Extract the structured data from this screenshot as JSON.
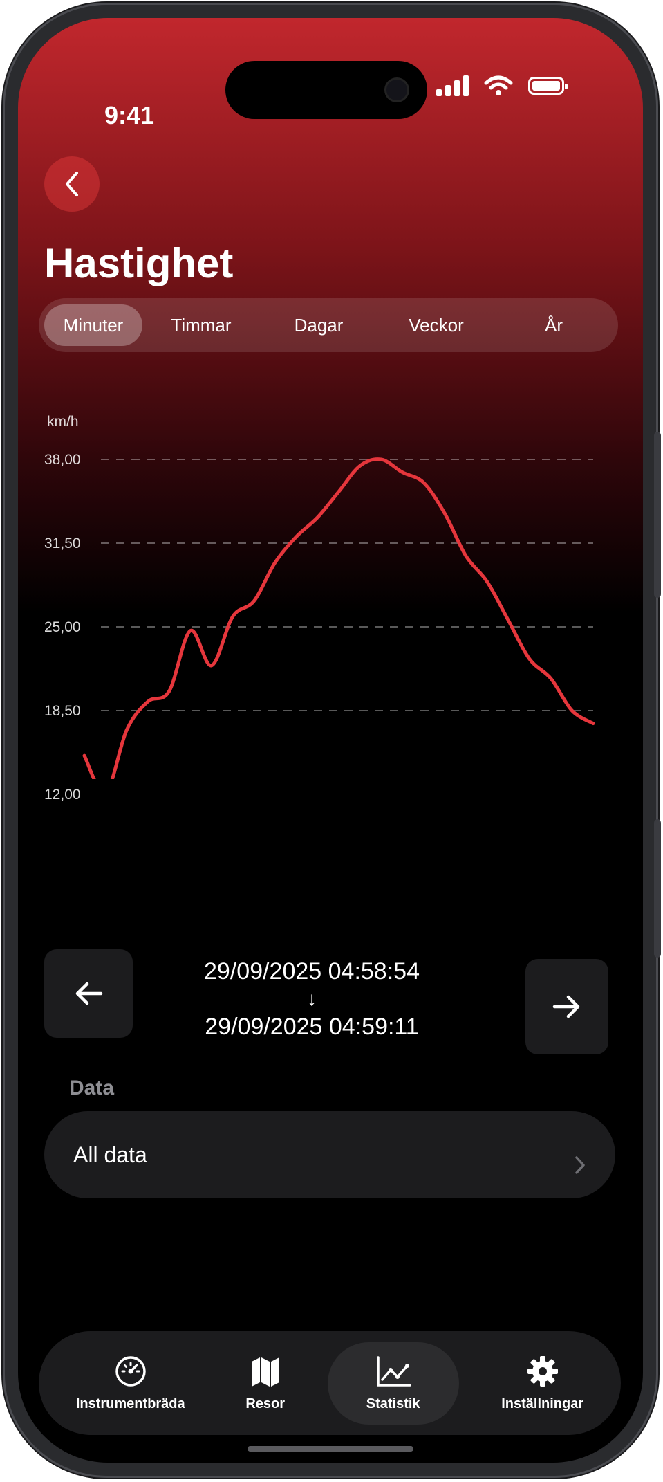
{
  "status_bar": {
    "time": "9:41"
  },
  "header": {
    "title": "Hastighet"
  },
  "period_tabs": [
    {
      "label": "Minuter",
      "active": true
    },
    {
      "label": "Timmar",
      "active": false
    },
    {
      "label": "Dagar",
      "active": false
    },
    {
      "label": "Veckor",
      "active": false
    },
    {
      "label": "År",
      "active": false
    }
  ],
  "chart_data": {
    "type": "line",
    "ylabel": "km/h",
    "yticks": [
      "12,00",
      "18,50",
      "25,00",
      "31,50",
      "38,00"
    ],
    "ylim": [
      12,
      38
    ],
    "grid": true,
    "color": "#e5363c",
    "series": [
      {
        "values": [
          15.0,
          12.1,
          17.0,
          19.2,
          20.0,
          24.7,
          22.0,
          25.8,
          27.0,
          30.0,
          32.0,
          33.5,
          35.5,
          37.5,
          38.0,
          37.0,
          36.2,
          33.8,
          30.5,
          28.5,
          25.5,
          22.5,
          21.0,
          18.5,
          17.5
        ]
      }
    ]
  },
  "pager": {
    "prev_icon": "arrow-left-icon",
    "next_icon": "arrow-right-icon",
    "range_start": "29/09/2025 04:58:54",
    "range_arrow": "↓",
    "range_end": "29/09/2025 04:59:11"
  },
  "data_section": {
    "label": "Data",
    "selected": "All data",
    "chevron_icon": "chevron-right-icon"
  },
  "tab_bar": [
    {
      "label": "Instrumentbräda",
      "icon": "speedometer-icon",
      "active": false
    },
    {
      "label": "Resor",
      "icon": "map-icon",
      "active": false
    },
    {
      "label": "Statistik",
      "icon": "chart-icon",
      "active": true
    },
    {
      "label": "Inställningar",
      "icon": "gear-icon",
      "active": false
    }
  ],
  "colors": {
    "accent": "#c1272d",
    "line": "#e5363c",
    "card": "#1c1c1e"
  }
}
